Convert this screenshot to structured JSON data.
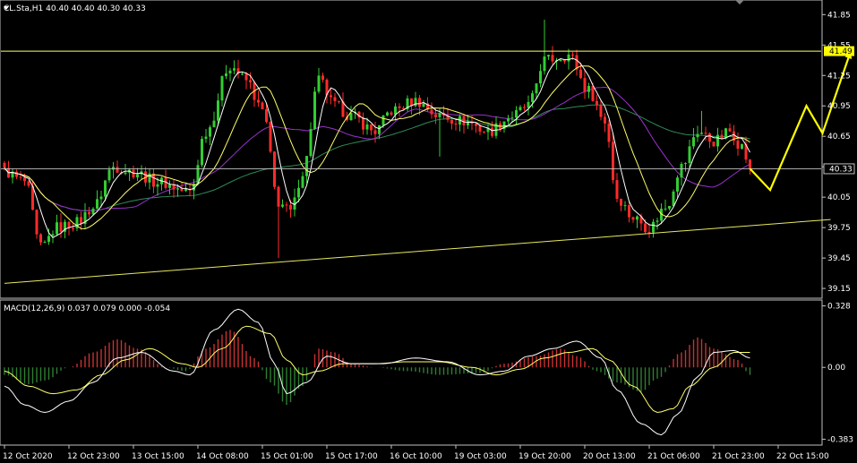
{
  "chart_data": {
    "type": "candlestick",
    "main": {
      "header": "CL.Sta,H1  40.40 40.40 40.30 40.33",
      "ylim": [
        39.08,
        41.95
      ],
      "yticks": [
        41.85,
        41.55,
        41.25,
        40.95,
        40.65,
        40.35,
        40.05,
        39.75,
        39.45,
        39.15
      ],
      "ytick_labels": [
        "41.85",
        "41.55",
        "41.25",
        "40.95",
        "40.65",
        "40.33",
        "40.05",
        "39.75",
        "39.45",
        "39.15"
      ],
      "bars": 205,
      "price_anchors": [
        [
          0,
          40.3
        ],
        [
          5,
          40.2
        ],
        [
          9,
          39.55
        ],
        [
          13,
          39.75
        ],
        [
          18,
          39.8
        ],
        [
          22,
          39.95
        ],
        [
          27,
          40.35
        ],
        [
          32,
          40.3
        ],
        [
          38,
          40.2
        ],
        [
          46,
          40.1
        ],
        [
          50,
          40.7
        ],
        [
          56,
          41.35
        ],
        [
          60,
          41.2
        ],
        [
          64,
          40.9
        ],
        [
          68,
          40.0
        ],
        [
          71,
          39.9
        ],
        [
          74,
          40.3
        ],
        [
          78,
          41.2
        ],
        [
          82,
          40.95
        ],
        [
          86,
          40.85
        ],
        [
          92,
          40.7
        ],
        [
          96,
          40.9
        ],
        [
          102,
          41.0
        ],
        [
          108,
          40.85
        ],
        [
          114,
          40.8
        ],
        [
          120,
          40.7
        ],
        [
          126,
          40.85
        ],
        [
          130,
          40.95
        ],
        [
          134,
          41.4
        ],
        [
          140,
          41.45
        ],
        [
          145,
          41.1
        ],
        [
          149,
          40.8
        ],
        [
          152,
          40.05
        ],
        [
          156,
          39.85
        ],
        [
          160,
          39.75
        ],
        [
          164,
          39.95
        ],
        [
          168,
          40.35
        ],
        [
          172,
          40.7
        ],
        [
          176,
          40.6
        ],
        [
          180,
          40.7
        ],
        [
          183,
          40.55
        ],
        [
          185,
          40.33
        ]
      ],
      "spikes": [
        [
          68,
          39.85,
          39.45
        ],
        [
          134,
          41.8,
          41.3
        ],
        [
          173,
          40.9,
          40.7
        ],
        [
          108,
          40.6,
          40.45
        ]
      ],
      "current_price": 40.33,
      "current_price_label": "40.33",
      "level_line": 41.49,
      "level_line_label": "41.49",
      "trendline": [
        [
          0,
          39.2
        ],
        [
          205,
          39.83
        ]
      ],
      "forecast_path": [
        [
          185,
          40.33
        ],
        [
          190,
          40.12
        ],
        [
          199,
          40.95
        ],
        [
          203,
          40.68
        ],
        [
          210,
          41.49
        ]
      ],
      "ma_periods": [
        5,
        13,
        26,
        60
      ],
      "colors": {
        "bull": "#32cd32",
        "bear": "#ff2a2a",
        "ma5": "#ffffff",
        "ma13": "#ffff66",
        "ma26": "#9932cc",
        "ma60": "#2e8b57",
        "level": "#ffff66",
        "trend": "#e8e860",
        "forecast": "#ffff00",
        "current": "#c0c0c0",
        "axis": "#c0c0c0",
        "badge_level_bg": "#ffff00",
        "badge_level_fg": "#000000",
        "badge_cur_bg": "#000000",
        "badge_cur_fg": "#ffffff"
      }
    },
    "macd": {
      "label": "MACD(12,26,9) 0.037 0.079 0.000 -0.054",
      "ylim": [
        -0.4,
        0.345
      ],
      "yticks": [
        0.328,
        0.0,
        -0.383
      ],
      "ytick_labels": [
        "0.328",
        "0.00",
        "-0.383"
      ],
      "hist_anchors": [
        [
          0,
          -0.04
        ],
        [
          6,
          -0.09
        ],
        [
          10,
          -0.07
        ],
        [
          16,
          0.0
        ],
        [
          22,
          0.08
        ],
        [
          28,
          0.15
        ],
        [
          33,
          0.1
        ],
        [
          40,
          0.0
        ],
        [
          45,
          -0.02
        ],
        [
          50,
          0.1
        ],
        [
          56,
          0.2
        ],
        [
          62,
          0.05
        ],
        [
          66,
          -0.08
        ],
        [
          70,
          -0.2
        ],
        [
          74,
          -0.1
        ],
        [
          78,
          0.1
        ],
        [
          82,
          0.08
        ],
        [
          86,
          0.02
        ],
        [
          92,
          0.0
        ],
        [
          100,
          -0.02
        ],
        [
          108,
          -0.04
        ],
        [
          118,
          -0.03
        ],
        [
          124,
          0.02
        ],
        [
          132,
          0.06
        ],
        [
          138,
          0.1
        ],
        [
          142,
          0.06
        ],
        [
          147,
          -0.02
        ],
        [
          152,
          -0.08
        ],
        [
          158,
          -0.13
        ],
        [
          162,
          -0.06
        ],
        [
          168,
          0.08
        ],
        [
          172,
          0.16
        ],
        [
          176,
          0.1
        ],
        [
          182,
          0.04
        ],
        [
          185,
          -0.04
        ]
      ],
      "macd_anchors": [
        [
          0,
          -0.1
        ],
        [
          5,
          -0.2
        ],
        [
          10,
          -0.24
        ],
        [
          16,
          -0.18
        ],
        [
          22,
          -0.08
        ],
        [
          28,
          0.05
        ],
        [
          34,
          0.08
        ],
        [
          42,
          -0.02
        ],
        [
          46,
          -0.04
        ],
        [
          52,
          0.2
        ],
        [
          58,
          0.31
        ],
        [
          63,
          0.24
        ],
        [
          67,
          0.02
        ],
        [
          70,
          -0.14
        ],
        [
          75,
          -0.08
        ],
        [
          80,
          0.06
        ],
        [
          86,
          0.02
        ],
        [
          94,
          0.02
        ],
        [
          102,
          0.05
        ],
        [
          110,
          0.03
        ],
        [
          118,
          -0.04
        ],
        [
          124,
          -0.02
        ],
        [
          130,
          0.06
        ],
        [
          136,
          0.1
        ],
        [
          142,
          0.14
        ],
        [
          148,
          0.05
        ],
        [
          152,
          -0.12
        ],
        [
          158,
          -0.3
        ],
        [
          163,
          -0.36
        ],
        [
          167,
          -0.25
        ],
        [
          172,
          -0.05
        ],
        [
          176,
          0.08
        ],
        [
          181,
          0.09
        ],
        [
          185,
          0.05
        ]
      ],
      "signal_anchors": [
        [
          0,
          -0.02
        ],
        [
          6,
          -0.1
        ],
        [
          12,
          -0.14
        ],
        [
          18,
          -0.12
        ],
        [
          24,
          -0.04
        ],
        [
          30,
          0.04
        ],
        [
          36,
          0.1
        ],
        [
          44,
          0.02
        ],
        [
          48,
          0.0
        ],
        [
          54,
          0.1
        ],
        [
          60,
          0.22
        ],
        [
          66,
          0.18
        ],
        [
          70,
          0.04
        ],
        [
          74,
          -0.04
        ],
        [
          78,
          -0.02
        ],
        [
          84,
          0.02
        ],
        [
          92,
          0.02
        ],
        [
          100,
          0.03
        ],
        [
          108,
          0.03
        ],
        [
          116,
          0.0
        ],
        [
          122,
          -0.04
        ],
        [
          128,
          -0.01
        ],
        [
          134,
          0.05
        ],
        [
          140,
          0.08
        ],
        [
          146,
          0.1
        ],
        [
          150,
          0.04
        ],
        [
          156,
          -0.1
        ],
        [
          162,
          -0.24
        ],
        [
          166,
          -0.22
        ],
        [
          170,
          -0.1
        ],
        [
          176,
          0.0
        ],
        [
          181,
          0.08
        ],
        [
          185,
          0.08
        ]
      ],
      "colors": {
        "hist_pos": "#c83232",
        "hist_neg": "#2e7d32",
        "macd": "#ffffff",
        "signal": "#ffff66"
      }
    },
    "time_labels": [
      {
        "bar": 0,
        "text": "12 Oct 2020"
      },
      {
        "bar": 16,
        "text": "12 Oct 23:00"
      },
      {
        "bar": 32,
        "text": "13 Oct 15:00"
      },
      {
        "bar": 48,
        "text": "14 Oct 08:00"
      },
      {
        "bar": 64,
        "text": "15 Oct 01:00"
      },
      {
        "bar": 80,
        "text": "15 Oct 17:00"
      },
      {
        "bar": 96,
        "text": "16 Oct 10:00"
      },
      {
        "bar": 112,
        "text": "19 Oct 03:00"
      },
      {
        "bar": 128,
        "text": "19 Oct 20:00"
      },
      {
        "bar": 144,
        "text": "20 Oct 13:00"
      },
      {
        "bar": 160,
        "text": "21 Oct 06:00"
      },
      {
        "bar": 176,
        "text": "21 Oct 23:00"
      },
      {
        "bar": 192,
        "text": "22 Oct 15:00"
      }
    ]
  }
}
